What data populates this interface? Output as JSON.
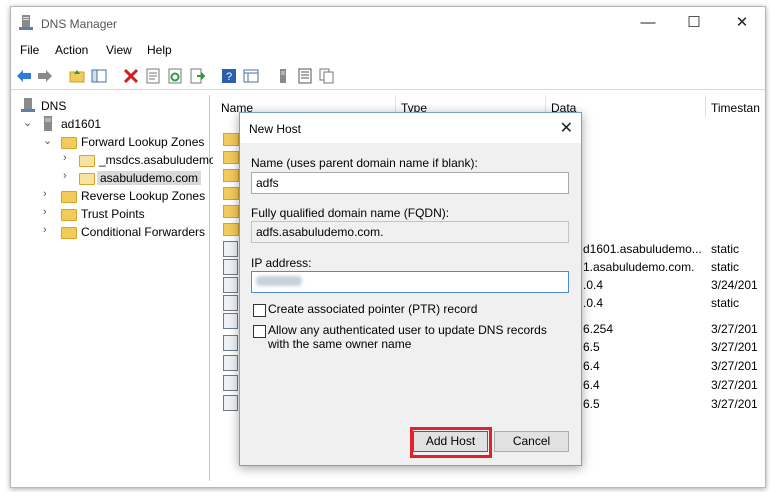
{
  "window": {
    "title": "DNS Manager"
  },
  "menu": [
    "File",
    "Action",
    "View",
    "Help"
  ],
  "toolbar_icons": [
    "back-arrow-icon",
    "forward-arrow-icon",
    "up-folder-icon",
    "console-tree-icon",
    "delete-icon",
    "properties-icon",
    "refresh-icon",
    "export-icon",
    "help-icon",
    "view-icon",
    "dns-server-icon",
    "list-icon",
    "copy-icon"
  ],
  "tree": {
    "root": "DNS",
    "server": "ad1601",
    "forward": "Forward Lookup Zones",
    "zone1": "_msdcs.asabuludemo",
    "zone2": "asabuludemo.com",
    "reverse": "Reverse Lookup Zones",
    "trust": "Trust Points",
    "conditional": "Conditional Forwarders"
  },
  "columns": {
    "name": "Name",
    "type": "Type",
    "data": "Data",
    "timestamp": "Timestan"
  },
  "rows": [
    {
      "data": "",
      "timestamp": ""
    },
    {
      "data": "",
      "timestamp": ""
    },
    {
      "data": "",
      "timestamp": ""
    },
    {
      "data": "",
      "timestamp": ""
    },
    {
      "data": "",
      "timestamp": ""
    },
    {
      "data": "",
      "timestamp": ""
    },
    {
      "data": "d1601.asabuludemo...",
      "timestamp": "static"
    },
    {
      "data": "1.asabuludemo.com.",
      "timestamp": "static"
    },
    {
      "data": ".0.4",
      "timestamp": "3/24/201"
    },
    {
      "data": ".0.4",
      "timestamp": "static"
    },
    {
      "data": "6.254",
      "timestamp": "3/27/201"
    },
    {
      "data": "6.5",
      "timestamp": "3/27/201"
    },
    {
      "data": "6.4",
      "timestamp": "3/27/201"
    },
    {
      "data": "6.4",
      "timestamp": "3/27/201"
    },
    {
      "data": "6.5",
      "timestamp": "3/27/201"
    }
  ],
  "dialog": {
    "title": "New Host",
    "name_label": "Name (uses parent domain name if blank):",
    "name_value": "adfs",
    "fqdn_label": "Fully qualified domain name (FQDN):",
    "fqdn_value": "adfs.asabuludemo.com.",
    "ip_label": "IP address:",
    "ptr_label": "Create associated pointer (PTR) record",
    "auth_label": "Allow any authenticated user to update DNS records with the same owner name",
    "add_button": "Add Host",
    "cancel_button": "Cancel"
  },
  "colors": {
    "highlight": "#e2222a",
    "selection": "#d9d9d9",
    "accent": "#0078d7"
  }
}
